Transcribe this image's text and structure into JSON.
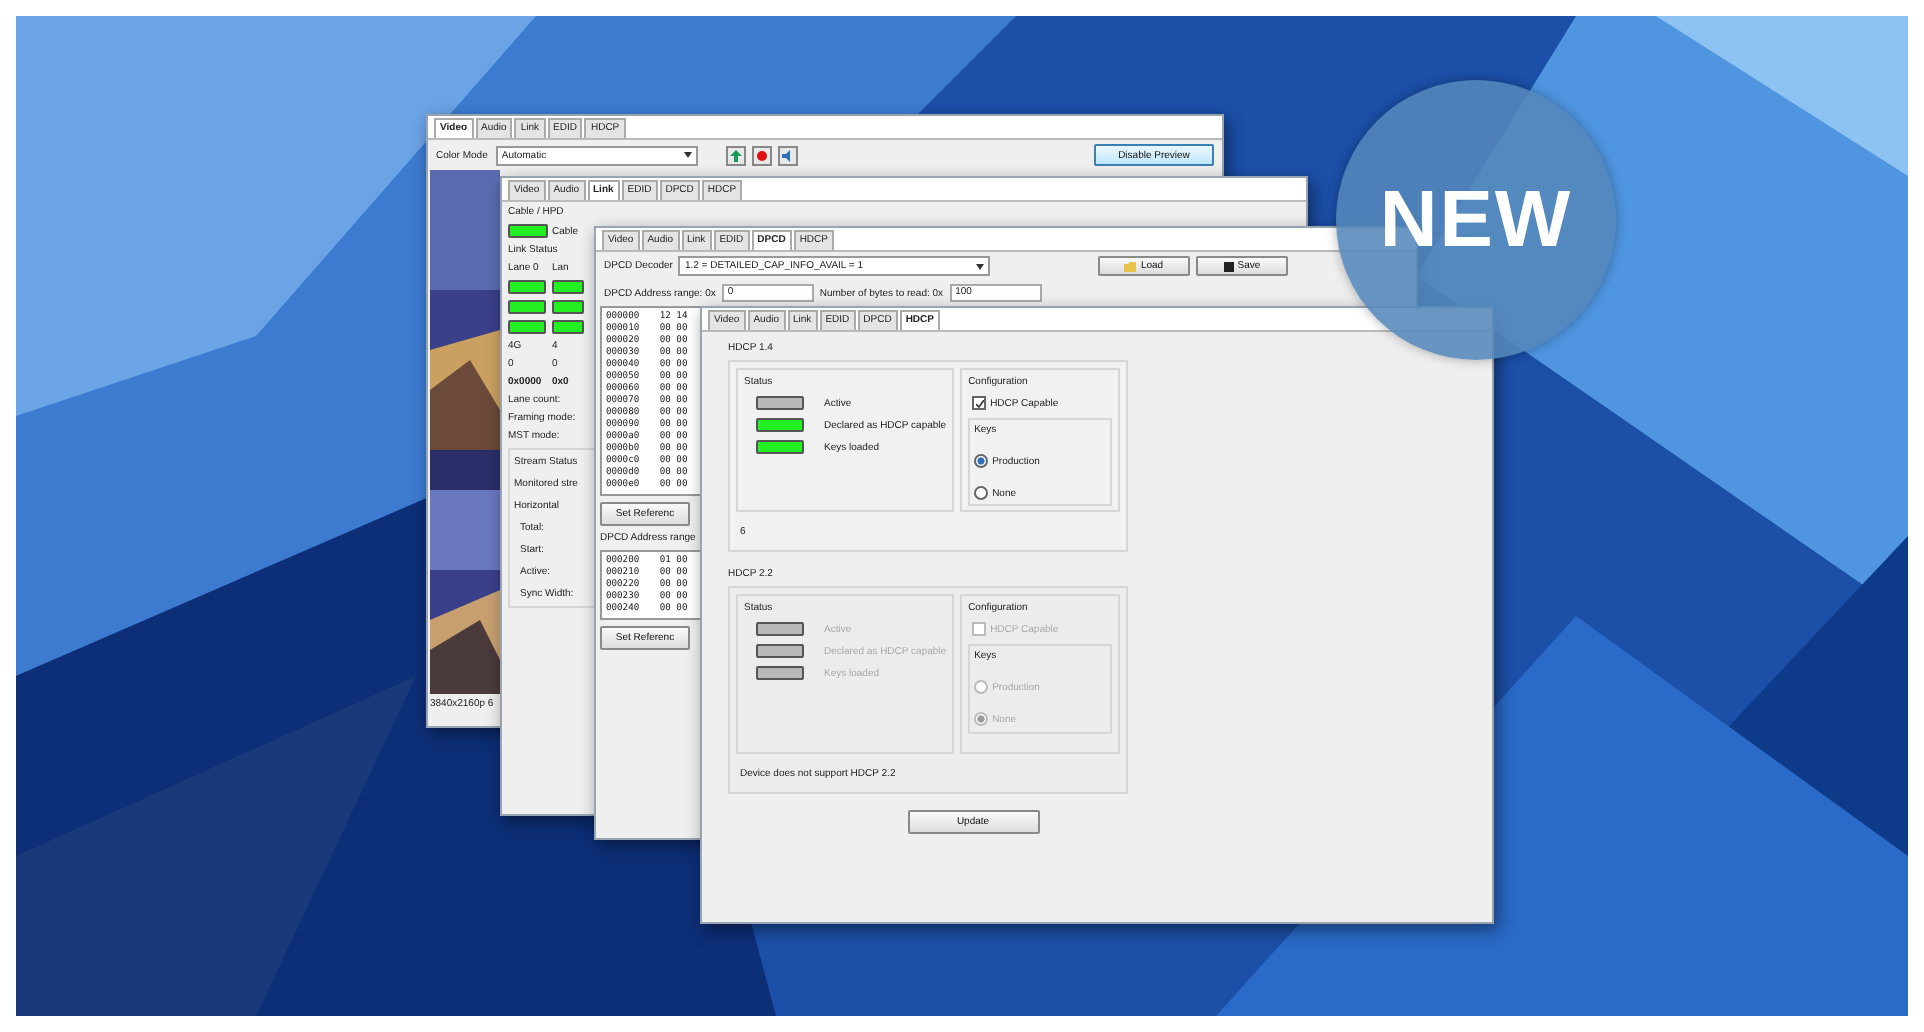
{
  "badge": "NEW",
  "video_window": {
    "tabs": [
      {
        "label": "Video",
        "selected": true
      },
      {
        "label": "Audio",
        "selected": false
      },
      {
        "label": "Link",
        "selected": false
      },
      {
        "label": "EDID",
        "selected": false
      },
      {
        "label": "HDCP",
        "selected": false
      }
    ],
    "color_mode_label": "Color Mode",
    "color_mode": "Automatic",
    "preview_button": "Disable Preview",
    "resolution": "3840x2160p 6"
  },
  "link_window": {
    "tabs": [
      {
        "label": "Video",
        "selected": false
      },
      {
        "label": "Audio",
        "selected": false
      },
      {
        "label": "Link",
        "selected": true
      },
      {
        "label": "EDID",
        "selected": false
      },
      {
        "label": "DPCD",
        "selected": false
      },
      {
        "label": "HDCP",
        "selected": false
      }
    ],
    "cable_label": "Cable / HPD",
    "cable": {
      "label": "Cable",
      "on": true
    },
    "link_status_label": "Link Status",
    "lanes": [
      {
        "label": "Lane 0",
        "indicators": [
          {
            "on": true
          },
          {
            "on": true
          },
          {
            "on": true
          }
        ],
        "rate": "4G",
        "count": "0",
        "code": "0x0000"
      },
      {
        "label": "Lan",
        "indicators": [
          {
            "on": true
          },
          {
            "on": true
          },
          {
            "on": true
          }
        ],
        "rate": "4",
        "count": "0",
        "code": "0x0"
      }
    ],
    "fields": [
      "Lane count:",
      "Framing mode:",
      "MST mode:"
    ],
    "stream_group": "Stream Status",
    "stream_fields": [
      {
        "label": "Monitored stre",
        "kind": "heading"
      },
      {
        "label": "Horizontal",
        "kind": "heading"
      },
      {
        "label": "Total:",
        "kind": "item"
      },
      {
        "label": "Start:",
        "kind": "item"
      },
      {
        "label": "Active:",
        "kind": "item"
      },
      {
        "label": "Sync Width:",
        "kind": "item"
      }
    ]
  },
  "dpcd_window": {
    "tabs": [
      {
        "label": "Video",
        "selected": false
      },
      {
        "label": "Audio",
        "selected": false
      },
      {
        "label": "Link",
        "selected": false
      },
      {
        "label": "EDID",
        "selected": false
      },
      {
        "label": "DPCD",
        "selected": true
      },
      {
        "label": "HDCP",
        "selected": false
      }
    ],
    "decoder_label": "DPCD Decoder",
    "decoder": "1.2 = DETAILED_CAP_INFO_AVAIL = 1",
    "load_button": "Load",
    "save_button": "Save",
    "address_label": "DPCD Address range: 0x",
    "address": "0",
    "bytes_label": "Number of bytes to read: 0x",
    "bytes": "100",
    "dumps": [
      {
        "rows": [
          {
            "address": "000000",
            "bytes": "12 14"
          },
          {
            "address": "000010",
            "bytes": "00 00"
          },
          {
            "address": "000020",
            "bytes": "00 00"
          },
          {
            "address": "000030",
            "bytes": "00 00"
          },
          {
            "address": "000040",
            "bytes": "00 00"
          },
          {
            "address": "000050",
            "bytes": "00 00"
          },
          {
            "address": "000060",
            "bytes": "00 00"
          },
          {
            "address": "000070",
            "bytes": "00 00"
          },
          {
            "address": "000080",
            "bytes": "00 00"
          },
          {
            "address": "000090",
            "bytes": "00 00"
          },
          {
            "address": "0000a0",
            "bytes": "00 00"
          },
          {
            "address": "0000b0",
            "bytes": "00 00"
          },
          {
            "address": "0000c0",
            "bytes": "00 00"
          },
          {
            "address": "0000d0",
            "bytes": "00 00"
          },
          {
            "address": "0000e0",
            "bytes": "00 00"
          }
        ],
        "button": "Set Referenc"
      },
      {
        "label": "DPCD Address range",
        "rows": [
          {
            "address": "000200",
            "bytes": "01 00"
          },
          {
            "address": "000210",
            "bytes": "00 00"
          },
          {
            "address": "000220",
            "bytes": "00 00"
          },
          {
            "address": "000230",
            "bytes": "00 00"
          },
          {
            "address": "000240",
            "bytes": "00 00"
          }
        ],
        "button": "Set Referenc"
      }
    ]
  },
  "hdcp_window": {
    "tabs": [
      {
        "label": "Video",
        "selected": false
      },
      {
        "label": "Audio",
        "selected": false
      },
      {
        "label": "Link",
        "selected": false
      },
      {
        "label": "EDID",
        "selected": false
      },
      {
        "label": "DPCD",
        "selected": false
      },
      {
        "label": "HDCP",
        "selected": true
      }
    ],
    "sections": [
      {
        "title": "HDCP 1.4",
        "enabled": true,
        "status_label": "Status",
        "indicators": [
          {
            "label": "Active",
            "on": false
          },
          {
            "label": "Declared as HDCP capable",
            "on": true
          },
          {
            "label": "Keys loaded",
            "on": true
          }
        ],
        "config_label": "Configuration",
        "capable": {
          "label": "HDCP Capable",
          "checked": true
        },
        "keys_label": "Keys",
        "keys": [
          {
            "label": "Production",
            "selected": true
          },
          {
            "label": "None",
            "selected": false
          }
        ],
        "note": "6"
      },
      {
        "title": "HDCP 2.2",
        "enabled": false,
        "status_label": "Status",
        "indicators": [
          {
            "label": "Active",
            "on": false
          },
          {
            "label": "Declared as HDCP capable",
            "on": false
          },
          {
            "label": "Keys loaded",
            "on": false
          }
        ],
        "config_label": "Configuration",
        "capable": {
          "label": "HDCP Capable",
          "checked": false
        },
        "keys_label": "Keys",
        "keys": [
          {
            "label": "Production",
            "selected": false
          },
          {
            "label": "None",
            "selected": true
          }
        ],
        "note": "Device does not support HDCP 2.2"
      }
    ],
    "update_button": "Update"
  }
}
